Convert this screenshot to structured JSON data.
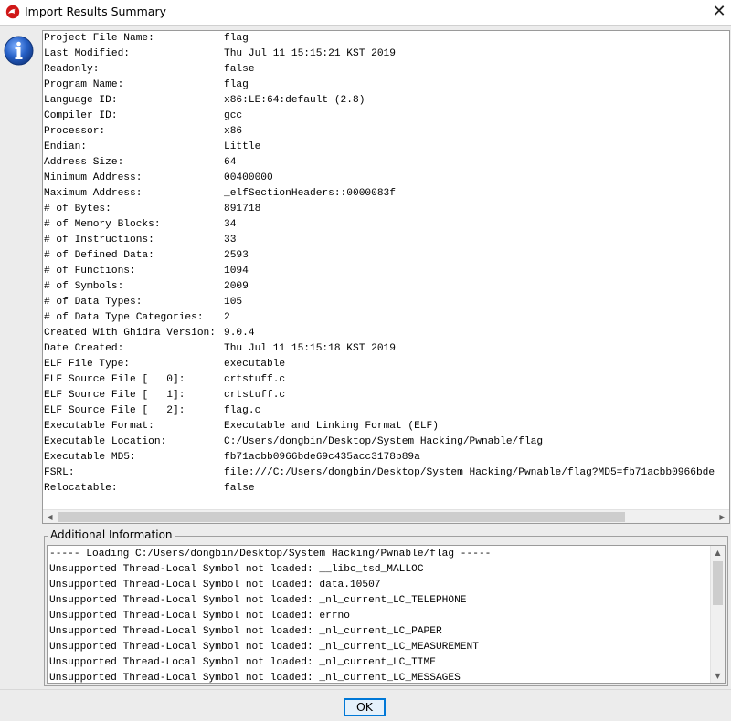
{
  "window": {
    "title": "Import Results Summary",
    "close_glyph": "✕",
    "icon": "ghidra-dragon-icon"
  },
  "dialog_icon": "info-icon",
  "summary": [
    {
      "key": "Project File Name:",
      "value": "flag"
    },
    {
      "key": "Last Modified:",
      "value": "Thu Jul 11 15:15:21 KST 2019"
    },
    {
      "key": "Readonly:",
      "value": "false"
    },
    {
      "key": "Program Name:",
      "value": "flag"
    },
    {
      "key": "Language ID:",
      "value": "x86:LE:64:default (2.8)"
    },
    {
      "key": "Compiler ID:",
      "value": "gcc"
    },
    {
      "key": "Processor:",
      "value": "x86"
    },
    {
      "key": "Endian:",
      "value": "Little"
    },
    {
      "key": "Address Size:",
      "value": "64"
    },
    {
      "key": "Minimum Address:",
      "value": "00400000"
    },
    {
      "key": "Maximum Address:",
      "value": "_elfSectionHeaders::0000083f"
    },
    {
      "key": "# of Bytes:",
      "value": "891718"
    },
    {
      "key": "# of Memory Blocks:",
      "value": "34"
    },
    {
      "key": "# of Instructions:",
      "value": "33"
    },
    {
      "key": "# of Defined Data:",
      "value": "2593"
    },
    {
      "key": "# of Functions:",
      "value": "1094"
    },
    {
      "key": "# of Symbols:",
      "value": "2009"
    },
    {
      "key": "# of Data Types:",
      "value": "105"
    },
    {
      "key": "# of Data Type Categories:",
      "value": "2"
    },
    {
      "key": "Created With Ghidra Version:",
      "value": "9.0.4"
    },
    {
      "key": "Date Created:",
      "value": "Thu Jul 11 15:15:18 KST 2019"
    },
    {
      "key": "ELF File Type:",
      "value": "executable"
    },
    {
      "key": "ELF Source File [   0]:",
      "value": "crtstuff.c"
    },
    {
      "key": "ELF Source File [   1]:",
      "value": "crtstuff.c"
    },
    {
      "key": "ELF Source File [   2]:",
      "value": "flag.c"
    },
    {
      "key": "Executable Format:",
      "value": "Executable and Linking Format (ELF)"
    },
    {
      "key": "Executable Location:",
      "value": "C:/Users/dongbin/Desktop/System Hacking/Pwnable/flag"
    },
    {
      "key": "Executable MD5:",
      "value": "fb71acbb0966bde69c435acc3178b89a"
    },
    {
      "key": "FSRL:",
      "value": "file:///C:/Users/dongbin/Desktop/System Hacking/Pwnable/flag?MD5=fb71acbb0966bde"
    },
    {
      "key": "Relocatable:",
      "value": "false"
    }
  ],
  "additional": {
    "legend": "Additional Information",
    "lines": [
      "----- Loading C:/Users/dongbin/Desktop/System Hacking/Pwnable/flag -----",
      "Unsupported Thread-Local Symbol not loaded: __libc_tsd_MALLOC",
      "Unsupported Thread-Local Symbol not loaded: data.10507",
      "Unsupported Thread-Local Symbol not loaded: _nl_current_LC_TELEPHONE",
      "Unsupported Thread-Local Symbol not loaded: errno",
      "Unsupported Thread-Local Symbol not loaded: _nl_current_LC_PAPER",
      "Unsupported Thread-Local Symbol not loaded: _nl_current_LC_MEASUREMENT",
      "Unsupported Thread-Local Symbol not loaded: _nl_current_LC_TIME",
      "Unsupported Thread-Local Symbol not loaded: _nl_current_LC_MESSAGES"
    ]
  },
  "scroll": {
    "left_arrow": "◀",
    "right_arrow": "▶",
    "up_arrow": "▲",
    "down_arrow": "▼"
  },
  "buttons": {
    "ok_label": "OK"
  },
  "colors": {
    "accent": "#0078d7",
    "info_blue": "#1f5fbf",
    "dragon_red": "#d01818"
  }
}
